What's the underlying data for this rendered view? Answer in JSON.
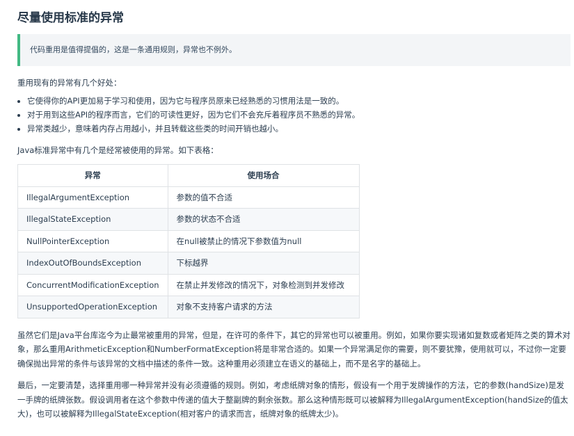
{
  "title": "尽量使用标准的异常",
  "tip": "代码重用是值得提倡的，这是一条通用规则，异常也不例外。",
  "intro": "重用现有的异常有几个好处：",
  "benefits": [
    "它使得你的API更加易于学习和使用，因为它与程序员原来已经熟悉的习惯用法是一致的。",
    "对于用到这些API的程序而言，它们的可读性更好，因为它们不会充斥着程序员不熟悉的异常。",
    "异常类越少，意味着内存占用越小，并且转载这些类的时间开销也越小。"
  ],
  "java_intro": "Java标准异常中有几个是经常被使用的异常。如下表格：",
  "table": {
    "headers": [
      "异常",
      "使用场合"
    ],
    "rows": [
      [
        "IllegalArgumentException",
        "参数的值不合适"
      ],
      [
        "IllegalStateException",
        "参数的状态不合适"
      ],
      [
        "NullPointerException",
        "在null被禁止的情况下参数值为null"
      ],
      [
        "IndexOutOfBoundsException",
        "下标越界"
      ],
      [
        "ConcurrentModificationException",
        "在禁止并发修改的情况下，对象检测到并发修改"
      ],
      [
        "UnsupportedOperationException",
        "对象不支持客户请求的方法"
      ]
    ]
  },
  "para1": "虽然它们是Java平台库迄今为止最常被重用的异常，但是，在许可的条件下，其它的异常也可以被重用。例如，如果你要实现诸如复数或者矩阵之类的算术对象，那么重用ArithmeticException和NumberFormatException将是非常合适的。如果一个异常满足你的需要，则不要犹豫，使用就可以，不过你一定要确保抛出异常的条件与该异常的文档中描述的条件一致。这种重用必须建立在语义的基础上，而不是名字的基础上。",
  "para2": "最后，一定要清楚，选择重用哪一种异常并没有必须遵循的规则。例如，考虑纸牌对象的情形，假设有一个用于发牌操作的方法，它的参数(handSize)是发一手牌的纸牌张数。假设调用者在这个参数中传递的值大于整副牌的剩余张数。那么这种情形既可以被解释为IllegalArgumentException(handSize的值太大)，也可以被解释为IllegalStateException(相对客户的请求而言，纸牌对象的纸牌太少)。"
}
